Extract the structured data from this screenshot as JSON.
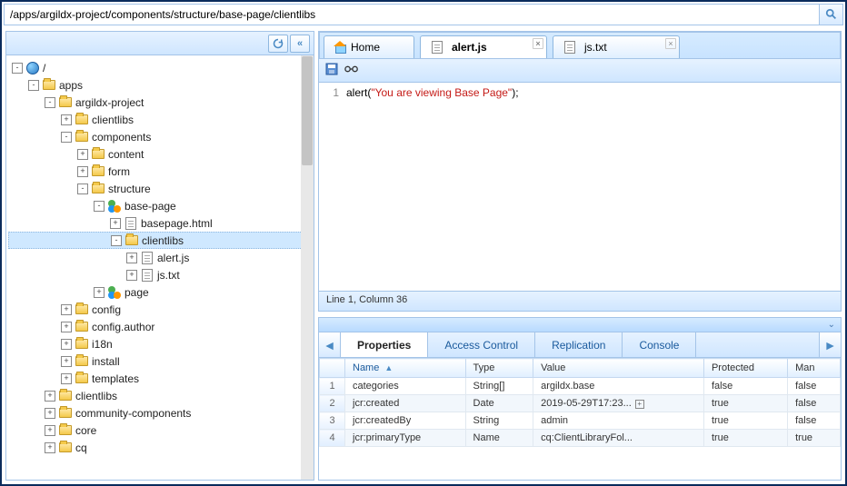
{
  "address_path": "/apps/argildx-project/components/structure/base-page/clientlibs",
  "tree": [
    {
      "d": 0,
      "t": "-",
      "i": "globe",
      "l": "/"
    },
    {
      "d": 1,
      "t": "-",
      "i": "folder",
      "l": "apps"
    },
    {
      "d": 2,
      "t": "-",
      "i": "folder",
      "l": "argildx-project"
    },
    {
      "d": 3,
      "t": "+",
      "i": "folder",
      "l": "clientlibs"
    },
    {
      "d": 3,
      "t": "-",
      "i": "folder",
      "l": "components"
    },
    {
      "d": 4,
      "t": "+",
      "i": "folder",
      "l": "content"
    },
    {
      "d": 4,
      "t": "+",
      "i": "folder",
      "l": "form"
    },
    {
      "d": 4,
      "t": "-",
      "i": "folder",
      "l": "structure"
    },
    {
      "d": 5,
      "t": "-",
      "i": "pkg",
      "l": "base-page"
    },
    {
      "d": 6,
      "t": "+",
      "i": "file",
      "l": "basepage.html"
    },
    {
      "d": 6,
      "t": "-",
      "i": "folder",
      "l": "clientlibs",
      "sel": true
    },
    {
      "d": 7,
      "t": "+",
      "i": "file",
      "l": "alert.js"
    },
    {
      "d": 7,
      "t": "+",
      "i": "file",
      "l": "js.txt"
    },
    {
      "d": 5,
      "t": "+",
      "i": "pkg",
      "l": "page"
    },
    {
      "d": 3,
      "t": "+",
      "i": "folder",
      "l": "config"
    },
    {
      "d": 3,
      "t": "+",
      "i": "folder",
      "l": "config.author"
    },
    {
      "d": 3,
      "t": "+",
      "i": "folder",
      "l": "i18n"
    },
    {
      "d": 3,
      "t": "+",
      "i": "folder",
      "l": "install"
    },
    {
      "d": 3,
      "t": "+",
      "i": "folder",
      "l": "templates"
    },
    {
      "d": 2,
      "t": "+",
      "i": "folder",
      "l": "clientlibs"
    },
    {
      "d": 2,
      "t": "+",
      "i": "folder",
      "l": "community-components"
    },
    {
      "d": 2,
      "t": "+",
      "i": "folder",
      "l": "core"
    },
    {
      "d": 2,
      "t": "+",
      "i": "folder",
      "l": "cq"
    }
  ],
  "editor_tabs": [
    {
      "label": "Home",
      "icon": "home",
      "active": false,
      "closable": false
    },
    {
      "label": "alert.js",
      "icon": "file",
      "active": true,
      "closable": true
    },
    {
      "label": "js.txt",
      "icon": "file",
      "active": false,
      "closable": true
    }
  ],
  "code": {
    "line_number": "1",
    "fn": "alert",
    "open": "(",
    "str": "\"You are viewing Base Page\"",
    "close": ");"
  },
  "status": "Line 1, Column 36",
  "prop_tabs": [
    "Properties",
    "Access Control",
    "Replication",
    "Console"
  ],
  "prop_tab_active": 0,
  "columns": [
    "",
    "Name",
    "Type",
    "Value",
    "Protected",
    "Man"
  ],
  "sort_col": 1,
  "rows": [
    {
      "n": "1",
      "name": "categories",
      "type": "String[]",
      "value": "argildx.base",
      "prot": "false",
      "man": "false",
      "expand": false
    },
    {
      "n": "2",
      "name": "jcr:created",
      "type": "Date",
      "value": "2019-05-29T17:23...",
      "prot": "true",
      "man": "false",
      "expand": true
    },
    {
      "n": "3",
      "name": "jcr:createdBy",
      "type": "String",
      "value": "admin",
      "prot": "true",
      "man": "false",
      "expand": false
    },
    {
      "n": "4",
      "name": "jcr:primaryType",
      "type": "Name",
      "value": "cq:ClientLibraryFol...",
      "prot": "true",
      "man": "true",
      "expand": false
    }
  ]
}
